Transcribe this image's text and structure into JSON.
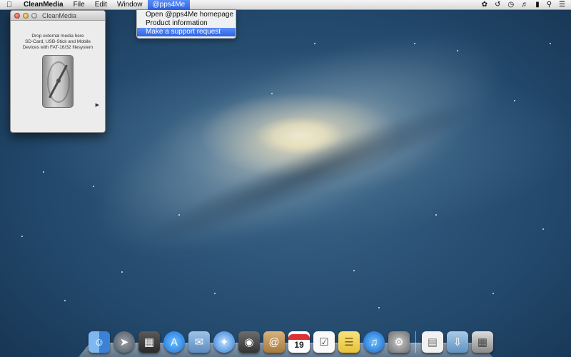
{
  "menubar": {
    "apple_icon": "apple-icon",
    "app_name": "CleanMedia",
    "menus": [
      "File",
      "Edit",
      "Window"
    ],
    "active_menu": "@pps4Me",
    "right_icons": [
      "paw-icon",
      "time-machine-icon",
      "clock-icon",
      "volume-icon",
      "battery-icon",
      "spotlight-icon",
      "list-icon"
    ]
  },
  "dropdown": {
    "items": [
      "Open @pps4Me homepage",
      "Product information",
      "Make a support request"
    ],
    "highlighted_index": 2
  },
  "window": {
    "title": "CleanMedia",
    "hint": "Drop external media here\nSD-Card, USB-Stick and Mobile\nDevices with FAT-16/32 filesystem",
    "hint_lines": [
      "Drop external media here",
      "SD-Card, USB-Stick and Mobile",
      "Devices with FAT-16/32 filesystem"
    ]
  },
  "dock": {
    "icons": [
      "finder-icon",
      "launchpad-icon",
      "mission-control-icon",
      "app-store-icon",
      "mail-icon",
      "safari-icon",
      "facetime-icon",
      "contacts-icon",
      "calendar-icon",
      "reminders-icon",
      "notes-icon",
      "itunes-icon",
      "system-preferences-icon",
      "documents-stack-icon",
      "downloads-folder-icon",
      "trash-icon"
    ],
    "calendar_day": "19"
  }
}
